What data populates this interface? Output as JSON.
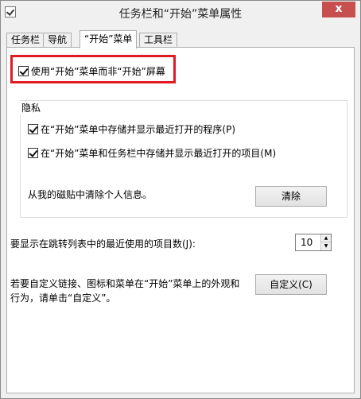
{
  "window": {
    "title": "任务栏和“开始”菜单属性",
    "close_glyph": "x"
  },
  "tabs": [
    {
      "label": "任务栏",
      "active": false
    },
    {
      "label": "导航",
      "active": false
    },
    {
      "label": "“开始”菜单",
      "active": true
    },
    {
      "label": "工具栏",
      "active": false
    }
  ],
  "use_start_menu": {
    "label": "使用“开始”菜单而非“开始”屏幕",
    "checked": true
  },
  "privacy": {
    "legend": "隐私",
    "store_programs": {
      "label": "在“开始”菜单中存储并显示最近打开的程序(P)",
      "checked": true
    },
    "store_items": {
      "label": "在“开始”菜单和任务栏中存储并显示最近打开的项目(M)",
      "checked": true
    },
    "clear_text": "从我的磁贴中清除个人信息。",
    "clear_button": "清除"
  },
  "jumplist": {
    "label": "要显示在跳转列表中的最近使用的项目数(J):",
    "value": "10"
  },
  "customize": {
    "text_line1": "若要自定义链接、图标和菜单在“开始”菜单上的外观和",
    "text_line2": "行为，请单击“自定义”。",
    "button": "自定义(C)"
  },
  "colors": {
    "highlight_border": "#e11b22",
    "close_button": "#c7504f"
  }
}
